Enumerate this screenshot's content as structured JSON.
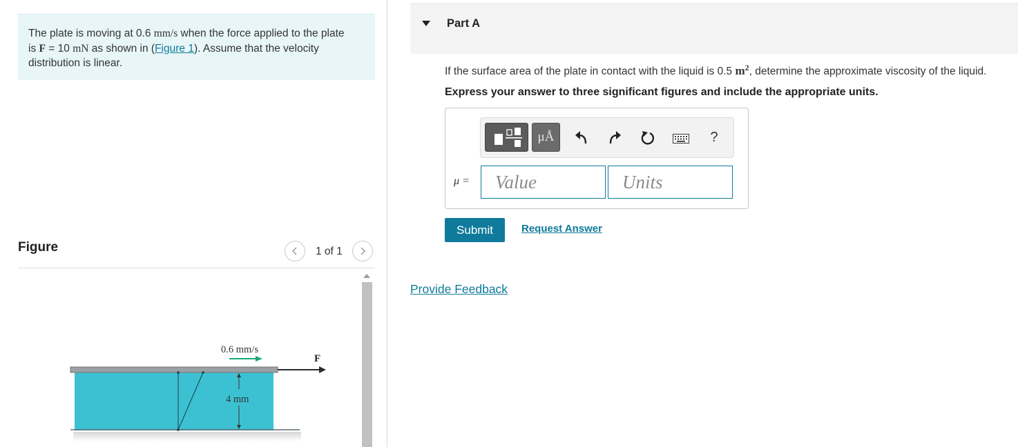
{
  "problem": {
    "text_1": "The plate is moving at 0.6 ",
    "speed_unit": "mm/s",
    "text_2": " when the force applied to the plate is ",
    "force_symbol": "F",
    "text_3": " = 10 ",
    "force_unit": "mN",
    "text_4": " as shown in (",
    "figure_link": "Figure 1",
    "text_5": "). Assume that the velocity distribution is linear."
  },
  "figure_panel": {
    "title": "Figure",
    "counter": "1 of 1",
    "prev_icon": "chevron-left-icon",
    "next_icon": "chevron-right-icon",
    "velocity_label": "0.6 mm/s",
    "force_label": "F",
    "gap_label": "4 mm",
    "colors": {
      "liquid": "#3cc1d3",
      "arrow": "#1aa67c",
      "plate": "#9aa0a4"
    }
  },
  "part": {
    "title": "Part A",
    "question_1": "If the surface area of the plate in contact with the liquid is 0.5 ",
    "area_unit": "m",
    "area_exp": "2",
    "question_2": ", determine the approximate viscosity of the liquid.",
    "instruction": "Express your answer to three significant figures and include the appropriate units."
  },
  "toolbar": {
    "templates_icon": "templates-icon",
    "symbols_label": "μÅ",
    "undo_icon": "undo-icon",
    "redo_icon": "redo-icon",
    "reset_icon": "reset-icon",
    "keyboard_icon": "keyboard-icon",
    "help_label": "?"
  },
  "answer": {
    "variable_label": "μ =",
    "value_placeholder": "Value",
    "units_placeholder": "Units"
  },
  "actions": {
    "submit": "Submit",
    "request_answer": "Request Answer",
    "provide_feedback": "Provide Feedback"
  },
  "colors": {
    "accent": "#0f7a9b",
    "problem_bg": "#e8f6f7"
  }
}
